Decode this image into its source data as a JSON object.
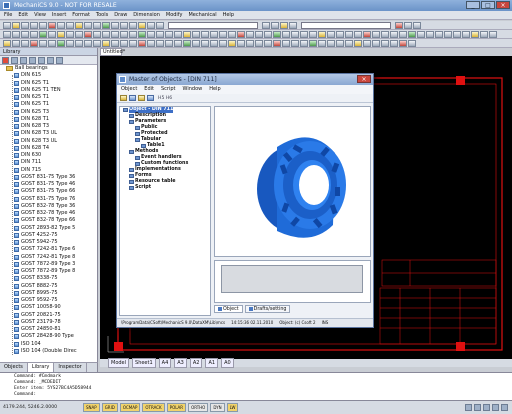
{
  "app": {
    "title": "MechaniCS 9.0 - NOT FOR RESALE"
  },
  "menu": [
    "File",
    "Edit",
    "View",
    "Insert",
    "Format",
    "Tools",
    "Draw",
    "Dimension",
    "Modify",
    "Mechanical",
    "Help"
  ],
  "library": {
    "header": "Library",
    "root": "Ball bearings",
    "items": [
      "DIN 615",
      "DIN 625 T1",
      "DIN 625 T1 TEN",
      "DIN 625 T1",
      "DIN 625 T1",
      "DIN 625 T3",
      "DIN 628 T1",
      "DIN 628 T3",
      "DIN 628 T3 UL",
      "DIN 628 T3 UL",
      "DIN 628 T4",
      "DIN 630",
      "DIN 711",
      "DIN 715",
      "GOST 831-75 Type 36",
      "GOST 831-75 Type 46",
      "GOST 831-75 Type 66",
      "GOST 831-75 Type 76",
      "GOST 832-78 Type 36",
      "GOST 832-78 Type 46",
      "GOST 832-78 Type 66",
      "GOST 2893-82 Type 5",
      "GOST 4252-75",
      "GOST 5942-75",
      "GOST 7242-81 Type 6",
      "GOST 7242-81 Type 8",
      "GOST 7872-89 Type 3",
      "GOST 7872-89 Type 8",
      "GOST 8338-75",
      "GOST 8882-75",
      "GOST 8995-75",
      "GOST 9592-75",
      "GOST 10058-90",
      "GOST 20821-75",
      "GOST 23179-78",
      "GOST 24850-81",
      "GOST 28428-90 Type",
      "ISO 104",
      "ISO 104 (Double Direc",
      "TSH 024030 TYP B 6",
      "TSH 024030 TYP 60L",
      "Ohne Imabeit TYP T"
    ],
    "tabs": [
      "Objects",
      "Library",
      "Inspector"
    ]
  },
  "drawing": {
    "tab": "Untitled*"
  },
  "layout_tabs": [
    "Model",
    "Sheet1",
    "A4",
    "A3",
    "A2",
    "A1",
    "A0"
  ],
  "command": {
    "lines": [
      "Command: #Cmdmark",
      "Command: _MCDEDIT",
      "Enter item: 5YS27BC4A5D58944",
      "Command:"
    ]
  },
  "status": {
    "coords": "4179.244, 5246.2.0000",
    "modes": [
      {
        "label": "SNAP",
        "on": true
      },
      {
        "label": "GRID",
        "on": true
      },
      {
        "label": "OCMAP",
        "on": true
      },
      {
        "label": "OTRACK",
        "on": true
      },
      {
        "label": "POLAR",
        "on": true
      },
      {
        "label": "ORTHO",
        "on": false
      },
      {
        "label": "DYN",
        "on": false
      },
      {
        "label": "LW",
        "on": true
      }
    ]
  },
  "dialog": {
    "title": "Master of Objects - [DIN 711]",
    "menu": [
      "Object",
      "Edit",
      "Script",
      "Window",
      "Help"
    ],
    "toolbar_text": "H5 H6",
    "tree": [
      {
        "label": "Object - DIN 711",
        "level": 0,
        "selected": true
      },
      {
        "label": "Description",
        "level": 1
      },
      {
        "label": "Parameters",
        "level": 1
      },
      {
        "label": "Public",
        "level": 2
      },
      {
        "label": "Protected",
        "level": 2
      },
      {
        "label": "Tabular",
        "level": 2
      },
      {
        "label": "Table1",
        "level": 3
      },
      {
        "label": "Methods",
        "level": 1
      },
      {
        "label": "Event handlers",
        "level": 2
      },
      {
        "label": "Custom functions",
        "level": 2
      },
      {
        "label": "Implementations",
        "level": 1
      },
      {
        "label": "Forms",
        "level": 1
      },
      {
        "label": "Resource table",
        "level": 1
      },
      {
        "label": "Script",
        "level": 1
      }
    ],
    "tabs": [
      "Object",
      "Drafts/setting"
    ],
    "status_path": "\\ProgramData\\CSoft\\MechanicS 9.0\\DataXM\\Lib\\mcs",
    "status_time": "14:15:36 02.11.2010",
    "status_obj": "Object: (c) Csoft 2",
    "status_ins": "INS"
  },
  "colors": {
    "part": "#1f6bd8",
    "drawing_bg": "#000000",
    "frame": "#e01010"
  }
}
